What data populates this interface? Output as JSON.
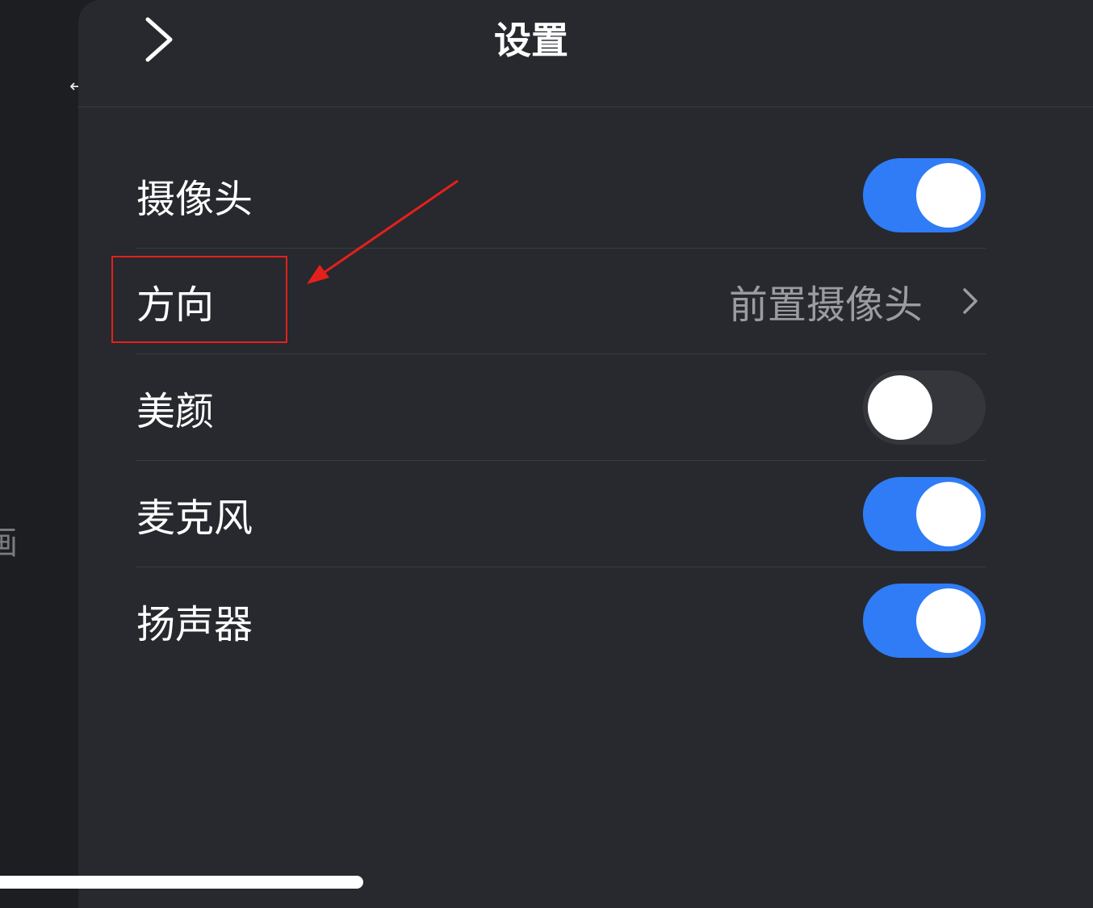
{
  "backdrop": {
    "partial_text": "画",
    "hook_glyph": "↩"
  },
  "header": {
    "title": "设置",
    "back_icon": "chevron-right-icon"
  },
  "settings": [
    {
      "label": "摄像头",
      "type": "toggle",
      "on": true
    },
    {
      "label": "方向",
      "type": "select",
      "value": "前置摄像头"
    },
    {
      "label": "美颜",
      "type": "toggle",
      "on": false
    },
    {
      "label": "麦克风",
      "type": "toggle",
      "on": true
    },
    {
      "label": "扬声器",
      "type": "toggle",
      "on": true
    }
  ],
  "colors": {
    "accent": "#2f7cf6",
    "panel": "#27292e",
    "annotation": "#e5201c"
  }
}
